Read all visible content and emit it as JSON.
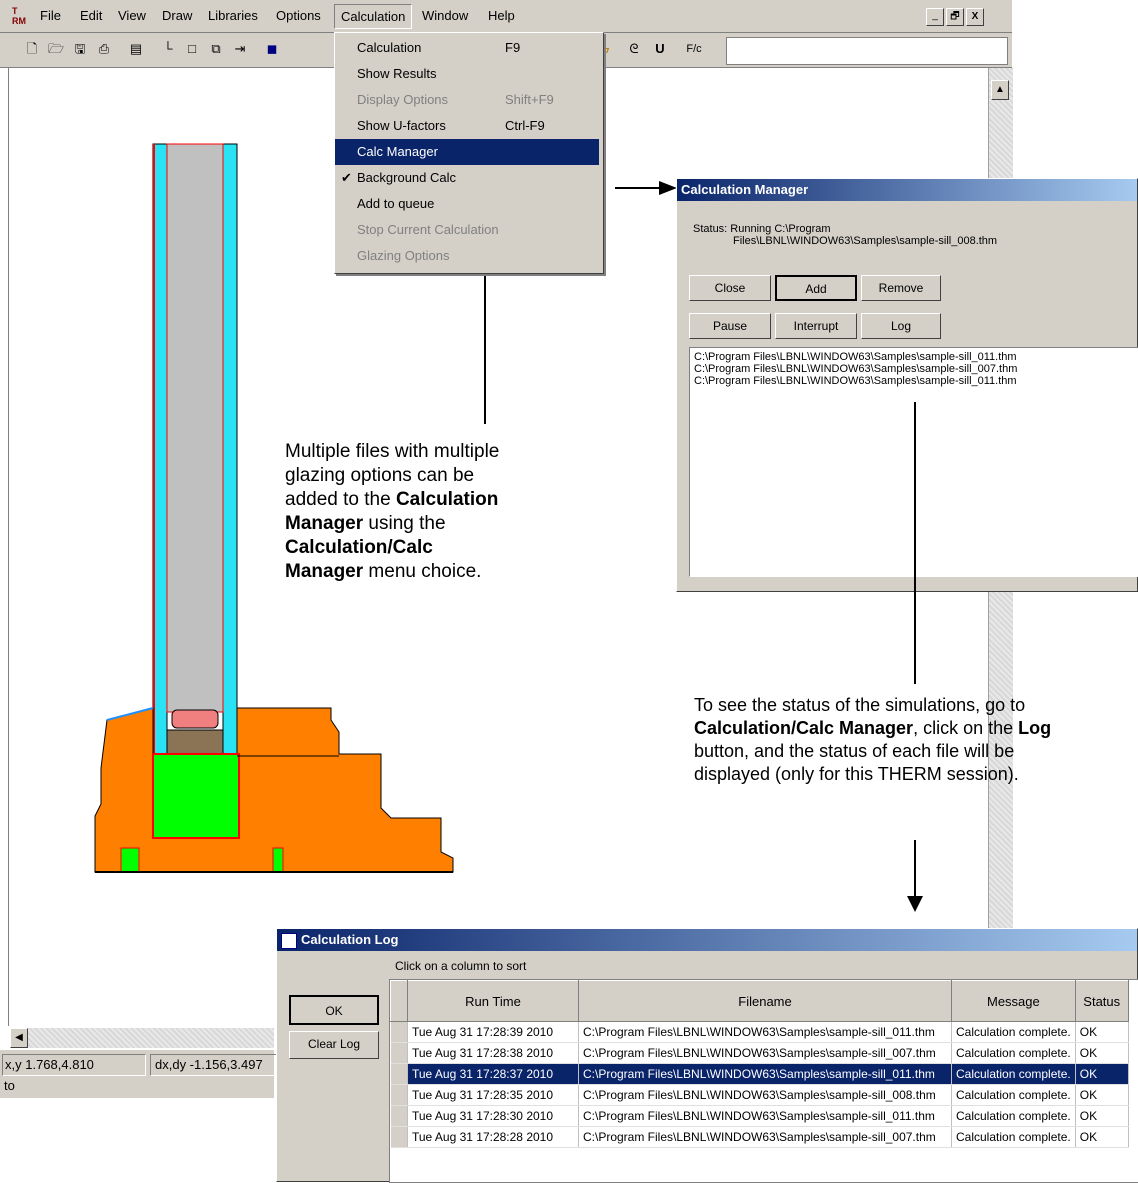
{
  "menubar": {
    "items": [
      "File",
      "Edit",
      "View",
      "Draw",
      "Libraries",
      "Options",
      "Calculation",
      "Window",
      "Help"
    ],
    "window_controls": [
      "_",
      "🗗",
      "X"
    ]
  },
  "calc_menu": {
    "items": [
      {
        "label": "Calculation",
        "shortcut": "F9",
        "disabled": false
      },
      {
        "label": "Show Results",
        "shortcut": "",
        "disabled": false
      },
      {
        "label": "Display Options",
        "shortcut": "Shift+F9",
        "disabled": true
      },
      {
        "label": "Show U-factors",
        "shortcut": "Ctrl-F9",
        "disabled": false
      },
      {
        "label": "Calc Manager",
        "shortcut": "",
        "disabled": false,
        "selected": true
      },
      {
        "label": "Background Calc",
        "shortcut": "",
        "disabled": false,
        "checked": true
      },
      {
        "label": "Add to queue",
        "shortcut": "",
        "disabled": false
      },
      {
        "label": "Stop Current Calculation",
        "shortcut": "",
        "disabled": true
      },
      {
        "label": "Glazing Options",
        "shortcut": "",
        "disabled": true
      }
    ]
  },
  "status_bar": {
    "xy": "x,y 1.768,4.810",
    "dxdy": "dx,dy -1.156,3.497",
    "mode": "to"
  },
  "calc_manager": {
    "title": "Calculation Manager",
    "status_line1": "Status:  Running C:\\Program",
    "status_line2": "Files\\LBNL\\WINDOW63\\Samples\\sample-sill_008.thm",
    "buttons": {
      "close": "Close",
      "add": "Add",
      "remove": "Remove",
      "pause": "Pause",
      "interrupt": "Interrupt",
      "log": "Log"
    },
    "queue": [
      "C:\\Program Files\\LBNL\\WINDOW63\\Samples\\sample-sill_011.thm",
      "C:\\Program Files\\LBNL\\WINDOW63\\Samples\\sample-sill_007.thm",
      "C:\\Program Files\\LBNL\\WINDOW63\\Samples\\sample-sill_011.thm"
    ]
  },
  "annotation1": {
    "t1": "Multiple files with multiple glazing options can be added to the ",
    "b1": "Calculation Manager",
    "t2": " using the ",
    "b2": "Calculation/Calc Manager",
    "t3": " menu choice."
  },
  "annotation2": {
    "t1": "To see the status of the simulations, go to ",
    "b1": "Calculation/Calc Manager",
    "t2": ", click on the ",
    "b2": "Log",
    "t3": " button, and the status of each file will be displayed (only for this THERM session)."
  },
  "calc_log": {
    "title": "Calculation Log",
    "hint": "Click on a column to sort",
    "ok": "OK",
    "clear": "Clear Log",
    "columns": [
      "Run Time",
      "Filename",
      "Message",
      "Status"
    ],
    "rows": [
      [
        "Tue Aug 31 17:28:39 2010",
        "C:\\Program Files\\LBNL\\WINDOW63\\Samples\\sample-sill_011.thm",
        "Calculation complete.",
        "OK"
      ],
      [
        "Tue Aug 31 17:28:38 2010",
        "C:\\Program Files\\LBNL\\WINDOW63\\Samples\\sample-sill_007.thm",
        "Calculation complete.",
        "OK"
      ],
      [
        "Tue Aug 31 17:28:37 2010",
        "C:\\Program Files\\LBNL\\WINDOW63\\Samples\\sample-sill_011.thm",
        "Calculation complete.",
        "OK"
      ],
      [
        "Tue Aug 31 17:28:35 2010",
        "C:\\Program Files\\LBNL\\WINDOW63\\Samples\\sample-sill_008.thm",
        "Calculation complete.",
        "OK"
      ],
      [
        "Tue Aug 31 17:28:30 2010",
        "C:\\Program Files\\LBNL\\WINDOW63\\Samples\\sample-sill_011.thm",
        "Calculation complete.",
        "OK"
      ],
      [
        "Tue Aug 31 17:28:28 2010",
        "C:\\Program Files\\LBNL\\WINDOW63\\Samples\\sample-sill_007.thm",
        "Calculation complete.",
        "OK"
      ]
    ],
    "selected_row": 2
  },
  "colors": {
    "glass": "#29e3f5",
    "frame": "#ff7f00",
    "spacer": "#00ff00",
    "selection": "#0a246a"
  }
}
